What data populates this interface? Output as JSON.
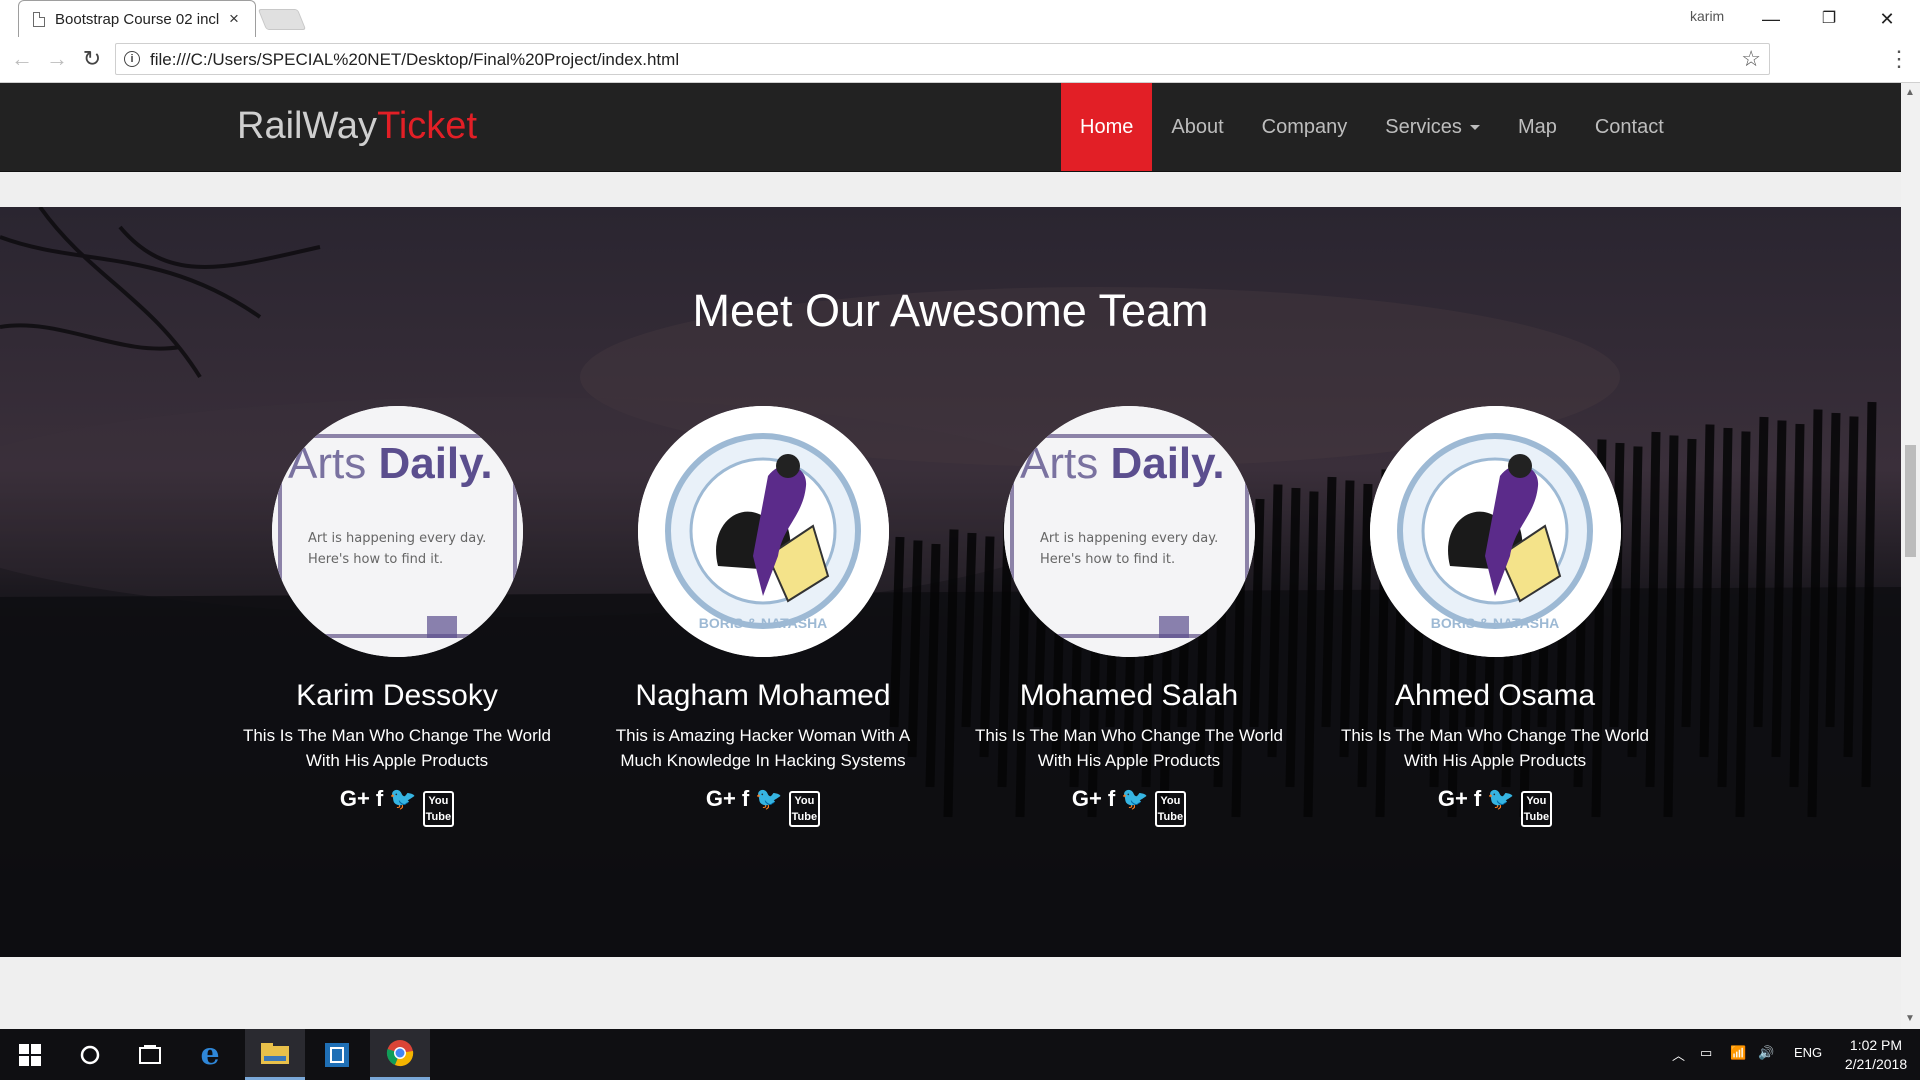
{
  "browser": {
    "tab_title": "Bootstrap Course 02 incl",
    "tab_close": "×",
    "profile_name": "karim",
    "window_controls": [
      "—",
      "❐",
      "✕"
    ],
    "url": "file:///C:/Users/SPECIAL%20NET/Desktop/Final%20Project/index.html"
  },
  "site": {
    "brand_part1": "RailWay",
    "brand_part2": "Ticket",
    "brand_colors": {
      "part1": "#cfcfcf",
      "part2": "#e21f26"
    },
    "nav": [
      {
        "label": "Home",
        "active": true
      },
      {
        "label": "About"
      },
      {
        "label": "Company"
      },
      {
        "label": "Services",
        "dropdown": true
      },
      {
        "label": "Map"
      },
      {
        "label": "Contact"
      }
    ],
    "accent_color": "#e21f26"
  },
  "team": {
    "title": "Meet Our Awesome Team",
    "members": [
      {
        "name": "Karim Dessoky",
        "bio": "This Is The Man Who Change The World With His Apple Products",
        "avatar_image": "arts-daily",
        "avatar_text": {
          "brand_a": "Arts ",
          "brand_b": "Daily.",
          "line1": "Art is happening every day.",
          "line2": "Here's how to find it."
        }
      },
      {
        "name": "Nagham Mohamed",
        "bio": "This is Amazing Hacker Woman With A Much Knowledge In Hacking Systems",
        "avatar_image": "boris-natasha",
        "avatar_text": {
          "ring": "BORIS & NATASHA"
        }
      },
      {
        "name": "Mohamed Salah",
        "bio": "This Is The Man Who Change The World With His Apple Products",
        "avatar_image": "arts-daily",
        "avatar_text": {
          "brand_a": "Arts ",
          "brand_b": "Daily.",
          "line1": "Art is happening every day.",
          "line2": "Here's how to find it."
        }
      },
      {
        "name": "Ahmed Osama",
        "bio": "This Is The Man Who Change The World With His Apple Products",
        "avatar_image": "boris-natasha",
        "avatar_text": {
          "ring": "BORIS & NATASHA"
        }
      }
    ],
    "social_icons": [
      "google-plus-icon",
      "facebook-icon",
      "twitter-icon",
      "youtube-icon"
    ],
    "social_glyphs": {
      "gplus": "G+",
      "facebook": "f",
      "twitter": "🐦",
      "youtube": "You Tube"
    }
  },
  "taskbar": {
    "apps": [
      "start-icon",
      "cortana-icon",
      "task-view-icon",
      "edge-icon",
      "file-explorer-icon",
      "app-icon",
      "chrome-icon"
    ],
    "language": "ENG",
    "time": "1:02 PM",
    "date": "2/21/2018"
  }
}
